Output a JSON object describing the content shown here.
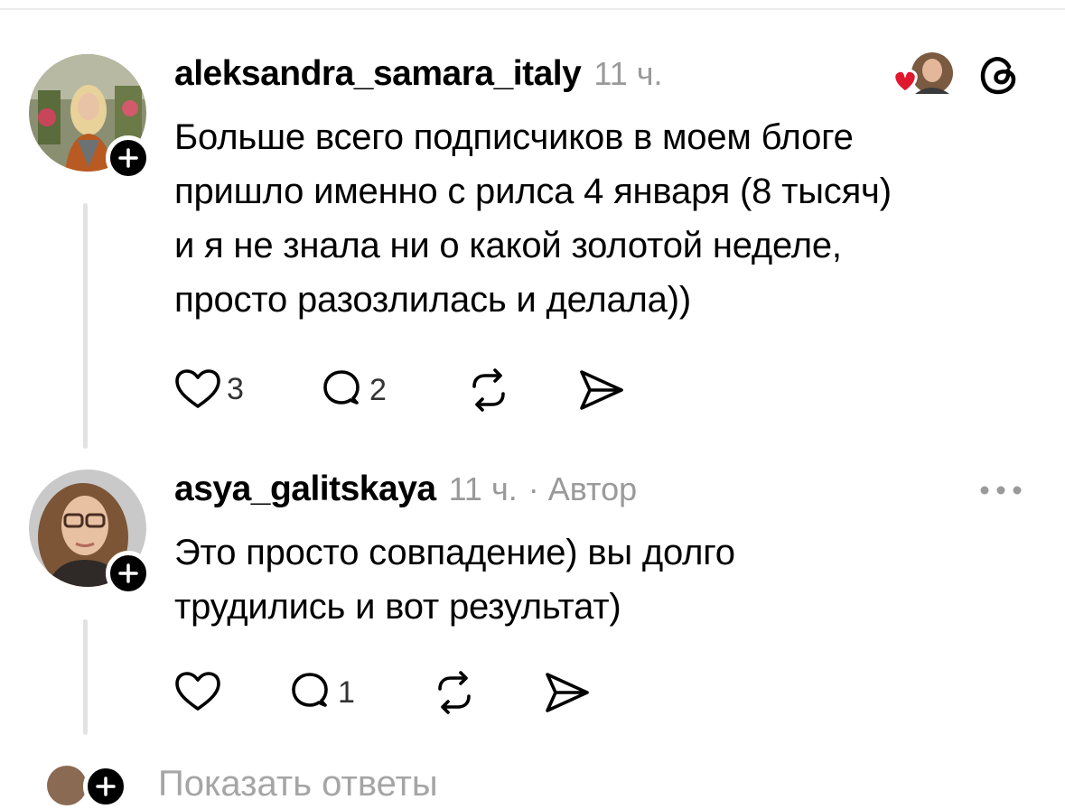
{
  "comments": [
    {
      "username": "aleksandra_samara_italy",
      "time": "11 ч.",
      "author_tag": "",
      "text_lines": [
        "Больше всего подписчиков в моем блоге",
        "пришло именно с рилса 4 января (8 тысяч)",
        "и я не знала ни о какой золотой неделе,",
        "просто разозлилась и делала))"
      ],
      "likes": "3",
      "replies": "2"
    },
    {
      "username": "asya_galitskaya",
      "time": "11 ч.",
      "author_tag": "· Автор",
      "text_lines": [
        "Это просто совпадение) вы долго",
        "трудились и вот результат)"
      ],
      "likes": "",
      "replies": "1"
    }
  ],
  "show_replies_label": "Показать ответы",
  "colors": {
    "text": "#000000",
    "meta": "#9a9a9a",
    "like_heart": "#e0182d",
    "thread_line": "#e2e2e2"
  },
  "icons": [
    "heart-icon",
    "comment-icon",
    "repost-icon",
    "share-icon",
    "threads-logo-icon",
    "more-icon",
    "plus-icon"
  ]
}
